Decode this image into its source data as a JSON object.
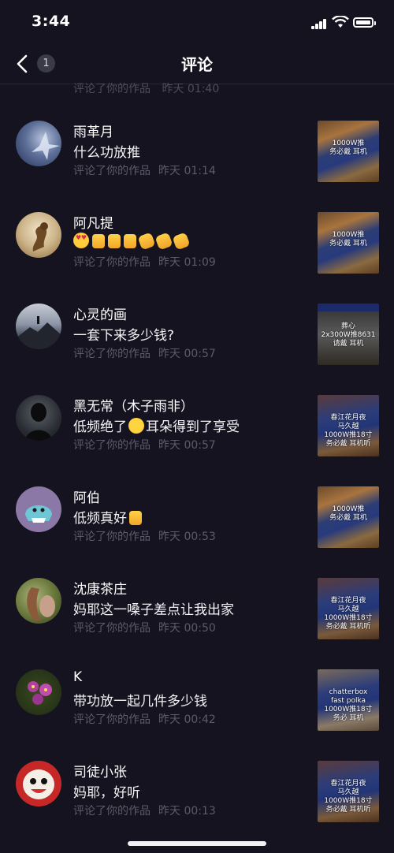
{
  "status_bar": {
    "time": "3:44"
  },
  "nav": {
    "title": "评论",
    "back_badge": "1"
  },
  "partial_row": {
    "meta": "评论了你的作品",
    "time": "昨天 01:40"
  },
  "rows": [
    {
      "name": "雨革月",
      "comment": "什么功放推",
      "meta": "评论了你的作品",
      "time": "昨天 01:14",
      "thumb_caption": "1000W推\n务必戴 耳机"
    },
    {
      "name": "阿凡提",
      "comment": "",
      "emojis": [
        "love",
        "thumb",
        "thumb",
        "thumb",
        "clap",
        "clap",
        "clap"
      ],
      "meta": "评论了你的作品",
      "time": "昨天 01:09",
      "thumb_caption": "1000W推\n务必戴 耳机"
    },
    {
      "name": "心灵的画",
      "comment": "一套下来多少钱?",
      "meta": "评论了你的作品",
      "time": "昨天 00:57",
      "thumb_caption": "葬心\n2x300W推8631\n请戴 耳机"
    },
    {
      "name": "黑无常（木子雨非）",
      "comment_prefix": "低频绝了",
      "comment_suffix": "耳朵得到了享受",
      "meta": "评论了你的作品",
      "time": "昨天 00:57",
      "thumb_caption": "春江花月夜\n马久越\n1000W推18寸\n务必戴 耳机听"
    },
    {
      "name": "阿伯",
      "comment": "低频真好",
      "meta": "评论了你的作品",
      "time": "昨天 00:53",
      "thumb_caption": "1000W推\n务必戴 耳机"
    },
    {
      "name": "沈康茶庄",
      "comment": "妈耶这一嗓子差点让我出家",
      "meta": "评论了你的作品",
      "time": "昨天 00:50",
      "thumb_caption": "春江花月夜\n马久越\n1000W推18寸\n务必戴 耳机听"
    },
    {
      "name": "K",
      "comment": "带功放一起几件多少钱",
      "meta": "评论了你的作品",
      "time": "昨天 00:42",
      "thumb_caption": "chatterbox\nfast polka\n1000W推18寸\n务必 耳机"
    },
    {
      "name": "司徒小张",
      "comment": "妈耶，好听",
      "meta": "评论了你的作品",
      "time": "昨天 00:13",
      "thumb_caption": "春江花月夜\n马久越\n1000W推18寸\n务必戴 耳机听"
    }
  ],
  "colors": {
    "background": "#15131f",
    "meta_text": "#5d5b6b",
    "divider": "#2a2838"
  }
}
